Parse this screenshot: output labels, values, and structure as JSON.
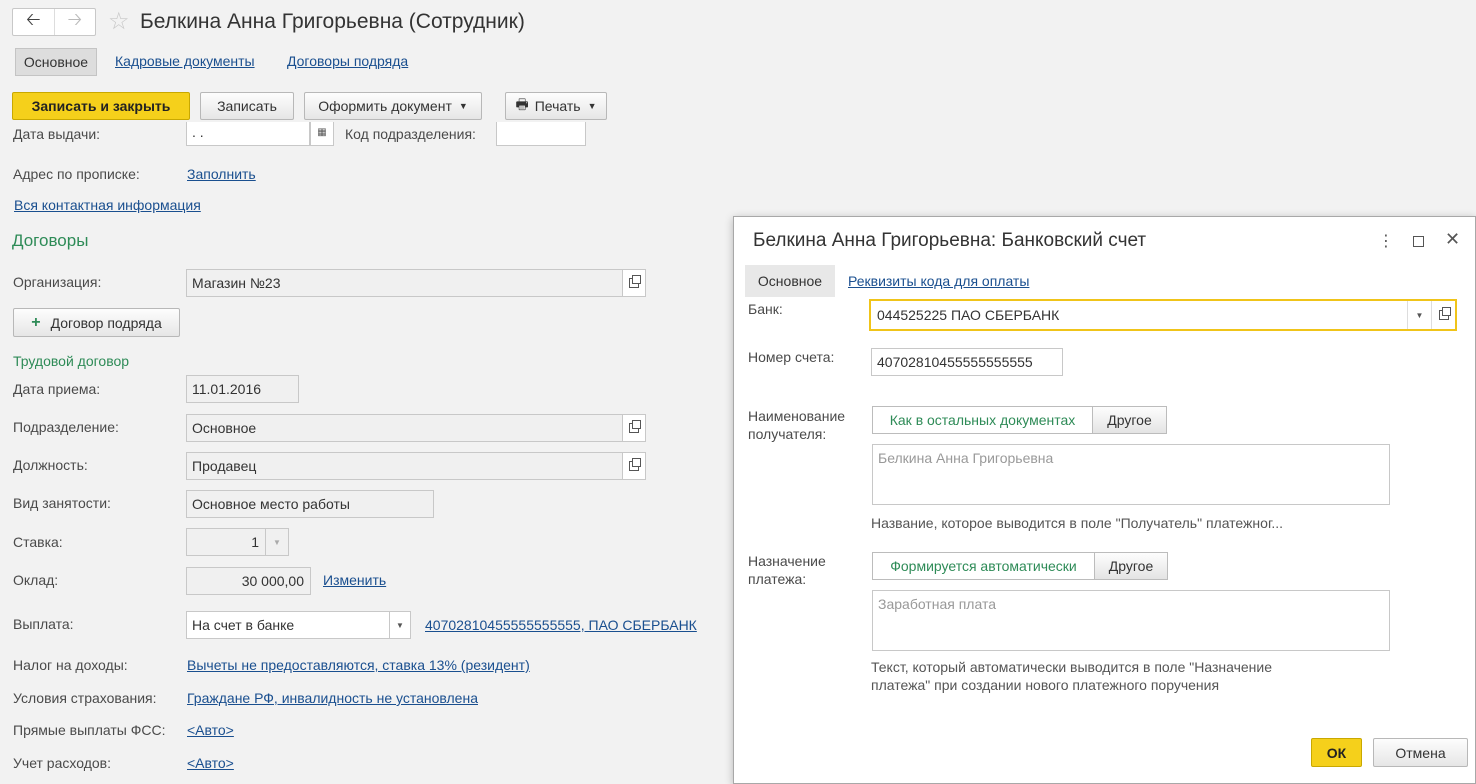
{
  "header": {
    "back_icon": "arrow-left-icon",
    "forward_icon": "arrow-right-icon",
    "star_icon": "star-icon",
    "title": "Белкина Анна Григорьевна (Сотрудник)"
  },
  "tabs": {
    "main": "Основное",
    "hr_docs": "Кадровые документы",
    "contracts": "Договоры подряда"
  },
  "toolbar": {
    "save_close": "Записать и закрыть",
    "save": "Записать",
    "make_doc": "Оформить документ",
    "print": "Печать"
  },
  "form": {
    "issue_date_label": "Дата выдачи:",
    "issue_date_value": ". .",
    "dept_code_label": "Код подразделения:",
    "address_label": "Адрес по прописке:",
    "address_fill": "Заполнить",
    "all_contacts": "Вся контактная информация",
    "section_contracts": "Договоры",
    "org_label": "Организация:",
    "org_value": "Магазин №23",
    "add_contract": "Договор подряда",
    "labor_contract": "Трудовой договор",
    "hire_date_label": "Дата приема:",
    "hire_date_value": "11.01.2016",
    "division_label": "Подразделение:",
    "division_value": "Основное",
    "position_label": "Должность:",
    "position_value": "Продавец",
    "employment_label": "Вид занятости:",
    "employment_value": "Основное место работы",
    "rate_label": "Ставка:",
    "rate_value": "1",
    "salary_label": "Оклад:",
    "salary_value": "30 000,00",
    "salary_change": "Изменить",
    "payout_label": "Выплата:",
    "payout_value": "На счет в банке",
    "payout_account": "40702810455555555555, ПАО СБЕРБАНК",
    "tax_label": "Налог на доходы:",
    "tax_value": "Вычеты не предоставляются, ставка 13% (резидент)",
    "insurance_label": "Условия страхования:",
    "insurance_value": "Граждане РФ, инвалидность не установлена",
    "fss_label": "Прямые выплаты ФСС:",
    "fss_value": "<Авто>",
    "expense_label": "Учет расходов:",
    "expense_value": "<Авто>"
  },
  "dialog": {
    "title": "Белкина Анна Григорьевна: Банковский счет",
    "more_icon": "more-vertical-icon",
    "maximize_icon": "maximize-icon",
    "close_icon": "close-icon",
    "tab_main": "Основное",
    "tab_payment_codes": "Реквизиты кода для оплаты",
    "bank_label": "Банк:",
    "bank_value": "044525225 ПАО СБЕРБАНК",
    "account_label": "Номер счета:",
    "account_value": "40702810455555555555",
    "recipient_label": "Наименование получателя:",
    "recipient_opt1": "Как в остальных документах",
    "recipient_opt2": "Другое",
    "recipient_text": "Белкина Анна  Григорьевна",
    "recipient_hint": "Название, которое выводится в поле \"Получатель\" платежног...",
    "purpose_label": "Назначение платежа:",
    "purpose_opt1": "Формируется автоматически",
    "purpose_opt2": "Другое",
    "purpose_text": "Заработная плата",
    "purpose_hint": "Текст, который автоматически выводится в поле \"Назначение платежа\" при создании нового платежного поручения",
    "ok": "ОК",
    "cancel": "Отмена"
  },
  "colors": {
    "accent_yellow": "#f5d01b",
    "section_green": "#2e8b57",
    "link_blue": "#1a4f8f"
  }
}
